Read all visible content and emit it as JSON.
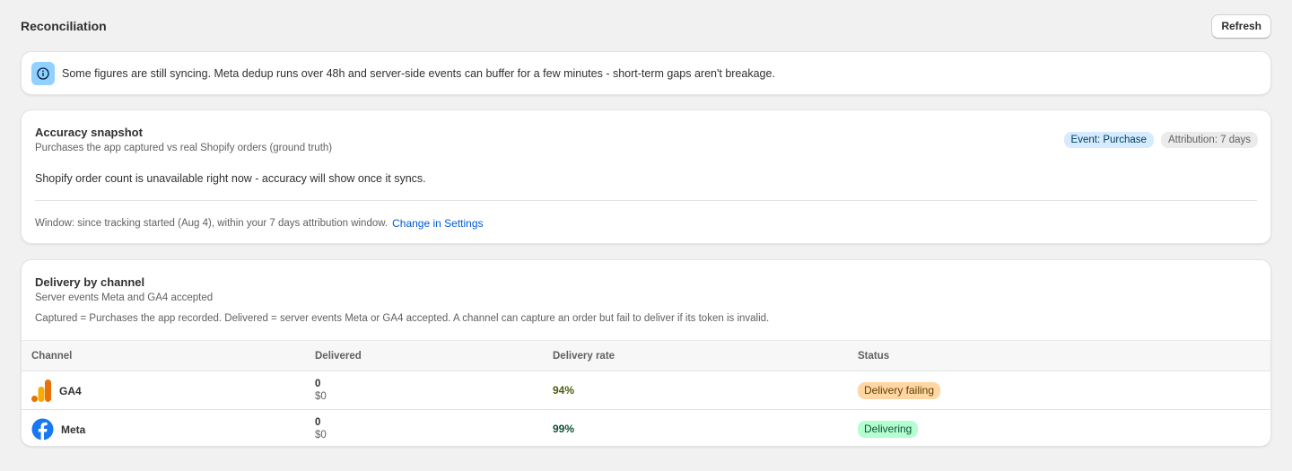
{
  "header": {
    "title": "Reconciliation",
    "refresh_label": "Refresh"
  },
  "banner": {
    "icon": "info-icon",
    "text": "Some figures are still syncing. Meta dedup runs over 48h and server-side events can buffer for a few minutes - short-term gaps aren't breakage."
  },
  "accuracy": {
    "title": "Accuracy snapshot",
    "subtitle": "Purchases the app captured vs real Shopify orders (ground truth)",
    "badges": {
      "event": "Event: Purchase",
      "attribution": "Attribution: 7 days"
    },
    "message": "Shopify order count is unavailable right now - accuracy will show once it syncs.",
    "window_text": "Window: since tracking started (Aug 4), within your 7 days attribution window.",
    "settings_link": "Change in Settings"
  },
  "delivery": {
    "title": "Delivery by channel",
    "subtitle": "Server events Meta and GA4 accepted",
    "description": "Captured = Purchases the app recorded. Delivered = server events Meta or GA4 accepted. A channel can capture an order but fail to deliver if its token is invalid.",
    "columns": {
      "channel": "Channel",
      "delivered": "Delivered",
      "rate": "Delivery rate",
      "status": "Status"
    },
    "rows": [
      {
        "channel": "GA4",
        "icon": "ga4-icon",
        "delivered": "0",
        "amount": "$0",
        "rate": "94%",
        "status": "Delivery failing",
        "status_color": "#ffd6a4",
        "rate_color": "#4a5e0a"
      },
      {
        "channel": "Meta",
        "icon": "facebook-icon",
        "delivered": "0",
        "amount": "$0",
        "rate": "99%",
        "status": "Delivering",
        "status_color": "#b4fed2",
        "rate_color": "#0c5132"
      }
    ]
  },
  "colors": {
    "accent": "#005bd3",
    "info": "#91d0ff",
    "ga4_orange": "#e8710a",
    "meta_blue": "#1877f2"
  }
}
